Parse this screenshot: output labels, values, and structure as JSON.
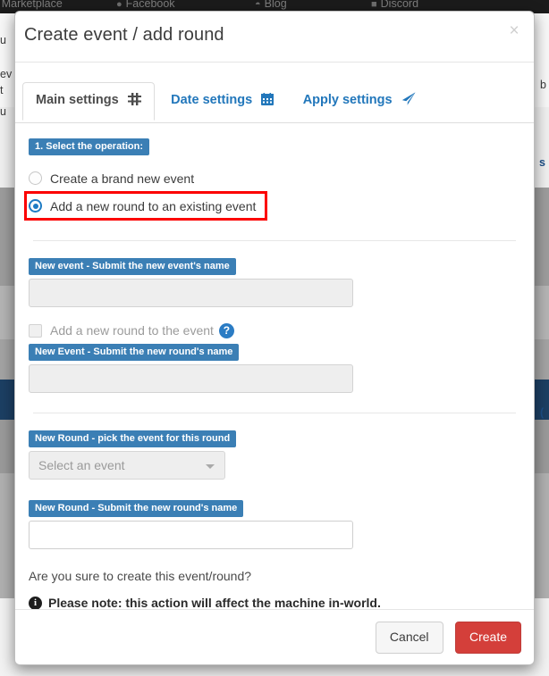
{
  "background": {
    "navbar_links": [
      {
        "icon": "cart-icon",
        "label": "Marketplace"
      },
      {
        "icon": "facebook-icon",
        "label": "Facebook"
      },
      {
        "icon": "wordpress-icon",
        "label": "Blog"
      },
      {
        "icon": "discord-icon",
        "label": "Discord"
      }
    ],
    "fragments": [
      {
        "text": "u"
      },
      {
        "text": "ev"
      },
      {
        "text": "t"
      },
      {
        "text": "u"
      },
      {
        "text": "b"
      },
      {
        "text": "s"
      },
      {
        "text": "("
      }
    ]
  },
  "modal": {
    "title": "Create event / add round",
    "close_label": "×",
    "tabs": [
      {
        "label": "Main settings",
        "icon": "sliders-icon",
        "active": true
      },
      {
        "label": "Date settings",
        "icon": "calendar-icon",
        "active": false
      },
      {
        "label": "Apply settings",
        "icon": "paper-plane-icon",
        "active": false
      }
    ],
    "operation_section": {
      "badge": "1. Select the operation:",
      "options": [
        {
          "label": "Create a brand new event",
          "checked": false,
          "highlighted": false
        },
        {
          "label": "Add a new round to an existing event",
          "checked": true,
          "highlighted": true
        }
      ]
    },
    "new_event": {
      "badge": "New event - Submit the new event's name",
      "value": "",
      "placeholder": "",
      "disabled": true
    },
    "add_round_checkbox": {
      "label": "Add a new round to the event",
      "checked": false,
      "disabled": true,
      "help_icon": "?"
    },
    "new_event_round": {
      "badge": "New Event - Submit the new round's name",
      "value": "",
      "placeholder": "",
      "disabled": true
    },
    "pick_event": {
      "badge": "New Round - pick the event for this round",
      "selected": "Select an event",
      "disabled": true
    },
    "new_round": {
      "badge": "New Round - Submit the new round's name",
      "value": "",
      "placeholder": "",
      "disabled": false
    },
    "confirm_question": "Are you sure to create this event/round?",
    "note": "Please note: this action will affect the machine in-world.",
    "footer": {
      "cancel_label": "Cancel",
      "create_label": "Create"
    }
  },
  "colors": {
    "badge_blue": "#3b7fb5",
    "link_blue": "#2277bb",
    "highlight_red": "#fc0000",
    "danger_red": "#d43f3a",
    "radio_blue": "#1e7bc4"
  }
}
